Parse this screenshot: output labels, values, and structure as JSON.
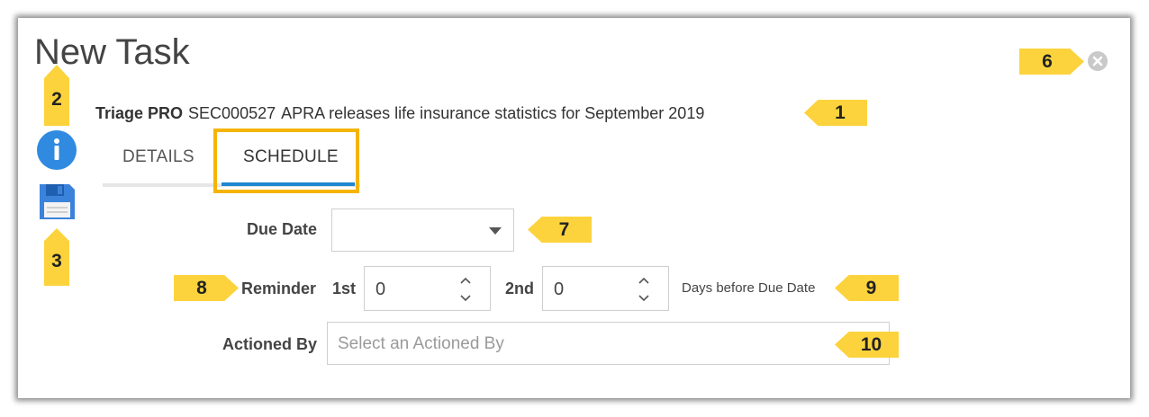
{
  "dialog": {
    "title": "New Task",
    "record_type": "Triage PRO",
    "record_code": "SEC000527",
    "record_title": "APRA releases life insurance statistics for September 2019"
  },
  "tabs": [
    {
      "label": "DETAILS",
      "active": false
    },
    {
      "label": "SCHEDULE",
      "active": true
    }
  ],
  "form": {
    "due_date_label": "Due Date",
    "due_date_value": "",
    "reminder_label": "Reminder",
    "first_label": "1st",
    "first_value": "0",
    "second_label": "2nd",
    "second_value": "0",
    "days_note": "Days before Due Date",
    "actioned_by_label": "Actioned By",
    "actioned_by_placeholder": "Select an Actioned By"
  },
  "callouts": [
    "1",
    "2",
    "3",
    "6",
    "7",
    "8",
    "9",
    "10"
  ],
  "icons": {
    "info": "info-icon",
    "save": "save-icon",
    "close": "close-icon",
    "dropdown": "chevron-down-icon",
    "stepper": "stepper-icon"
  },
  "colors": {
    "callout": "#fcd33d",
    "highlight": "#f5b400",
    "tab_active": "#1e88d3",
    "info_icon": "#2f8ae0",
    "save_icon": "#3b82db"
  }
}
